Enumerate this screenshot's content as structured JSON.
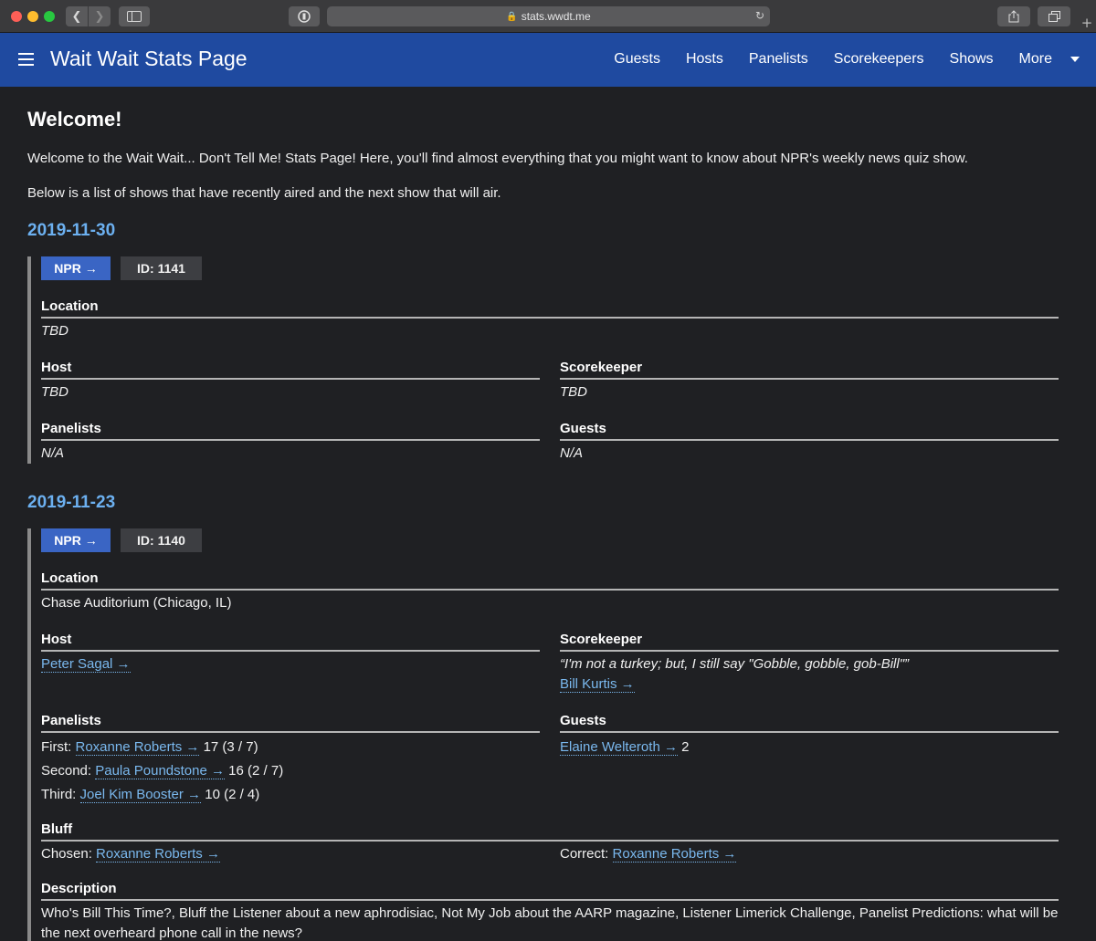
{
  "browser": {
    "url": "stats.wwdt.me"
  },
  "navbar": {
    "brand": "Wait Wait Stats Page",
    "links": [
      "Guests",
      "Hosts",
      "Panelists",
      "Scorekeepers",
      "Shows",
      "More"
    ]
  },
  "page": {
    "heading": "Welcome!",
    "intro": "Welcome to the Wait Wait... Don't Tell Me! Stats Page! Here, you'll find almost everything that you might want to know about NPR's weekly news quiz show.",
    "intro2": "Below is a list of shows that have recently aired and the next show that will air."
  },
  "shows": [
    {
      "date": "2019-11-30",
      "npr_label": "NPR →",
      "id_label": "ID: 1141",
      "location_label": "Location",
      "location": "TBD",
      "host_label": "Host",
      "host": "TBD",
      "scorekeeper_label": "Scorekeeper",
      "scorekeeper": "TBD",
      "panelists_label": "Panelists",
      "panelists": "N/A",
      "guests_label": "Guests",
      "guests": "N/A"
    },
    {
      "date": "2019-11-23",
      "npr_label": "NPR →",
      "id_label": "ID: 1140",
      "location_label": "Location",
      "location": "Chase Auditorium (Chicago, IL)",
      "host_label": "Host",
      "host": "Peter Sagal →",
      "scorekeeper_label": "Scorekeeper",
      "scorekeeper_quote": "“I'm not a turkey; but, I still say \"Gobble, gobble, gob-Bill\"”",
      "scorekeeper": "Bill Kurtis →",
      "panelists_label": "Panelists",
      "panelists": [
        {
          "place": "First:",
          "name": "Roxanne Roberts →",
          "score": "17 (3 / 7)"
        },
        {
          "place": "Second:",
          "name": "Paula Poundstone →",
          "score": "16 (2 / 7)"
        },
        {
          "place": "Third:",
          "name": "Joel Kim Booster →",
          "score": "10 (2 / 4)"
        }
      ],
      "guests_label": "Guests",
      "guest": {
        "name": "Elaine Welteroth →",
        "score": "2"
      },
      "bluff_label": "Bluff",
      "bluff_chosen_label": "Chosen:",
      "bluff_chosen": "Roxanne Roberts →",
      "bluff_correct_label": "Correct:",
      "bluff_correct": "Roxanne Roberts →",
      "description_label": "Description",
      "description": "Who's Bill This Time?, Bluff the Listener about a new aphrodisiac, Not My Job about the AARP magazine, Listener Limerick Challenge, Panelist Predictions: what will be the next overheard phone call in the news?"
    }
  ]
}
